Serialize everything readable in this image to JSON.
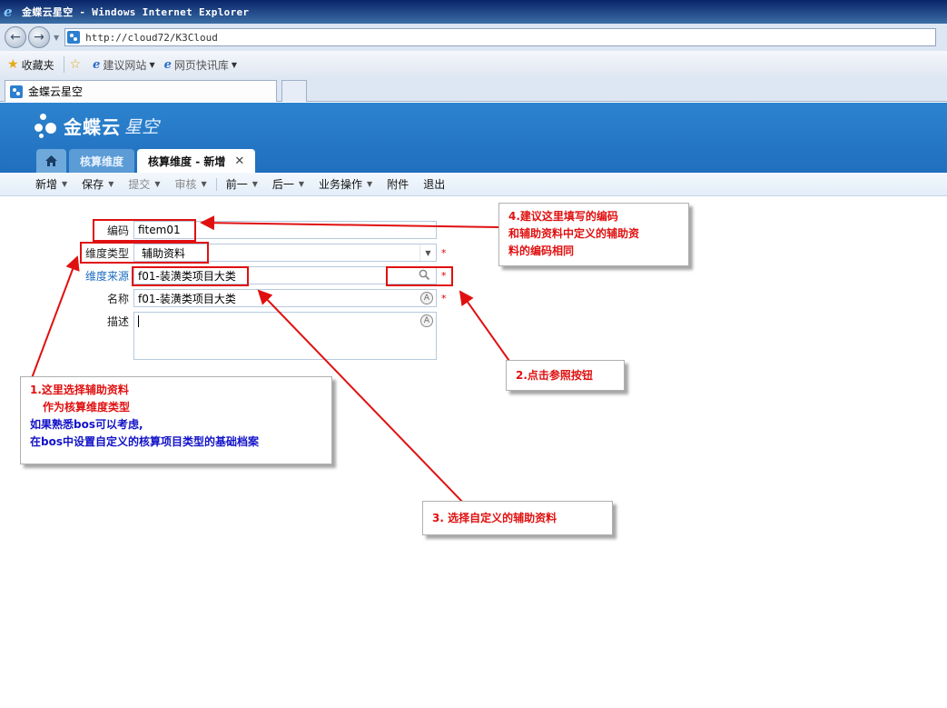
{
  "browser": {
    "title": "金蝶云星空 - Windows Internet Explorer",
    "url": "http://cloud72/K3Cloud",
    "favorites_label": "收藏夹",
    "fav_links": [
      "建议网站",
      "网页快讯库"
    ],
    "tab_title": "金蝶云星空"
  },
  "app": {
    "logo_main": "金蝶云",
    "logo_sub": "星空",
    "tabs": [
      {
        "label": "核算维度"
      },
      {
        "label": "核算维度 - 新增"
      }
    ],
    "toolbar": [
      {
        "label": "新增",
        "dropdown": true
      },
      {
        "label": "保存",
        "dropdown": true
      },
      {
        "label": "提交",
        "dropdown": true,
        "disabled": true
      },
      {
        "label": "审核",
        "dropdown": true,
        "disabled": true
      },
      {
        "label": "前一",
        "dropdown": true
      },
      {
        "label": "后一",
        "dropdown": true
      },
      {
        "label": "业务操作",
        "dropdown": true
      },
      {
        "label": "附件",
        "dropdown": false
      },
      {
        "label": "退出",
        "dropdown": false
      }
    ]
  },
  "form": {
    "code_label": "编码",
    "code_value": "fitem01",
    "type_label": "维度类型",
    "type_value": "辅助资料",
    "source_label": "维度来源",
    "source_value": "f01-装潢类项目大类",
    "name_label": "名称",
    "name_value": "f01-装潢类项目大类",
    "desc_label": "描述",
    "desc_value": "",
    "required_mark": "*"
  },
  "annotations": {
    "note1": [
      "1.这里选择辅助资料",
      "作为核算维度类型",
      "如果熟悉bos可以考虑,",
      "在bos中设置自定义的核算项目类型的基础档案"
    ],
    "note2": "2.点击参照按钮",
    "note3": "3.  选择自定义的辅助资料",
    "note4": [
      "4.建议这里填写的编码",
      "和辅助资料中定义的辅助资",
      "料的编码相同"
    ],
    "highlight_color": "#e01010"
  }
}
